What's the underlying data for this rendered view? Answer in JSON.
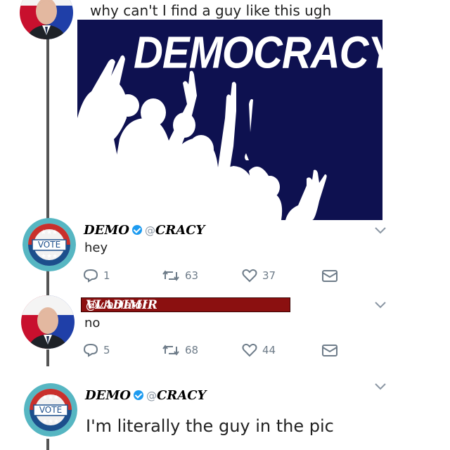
{
  "top_tweet": {
    "text": "why can't I find a guy like this ugh"
  },
  "image": {
    "title": "DEMOCRACY!",
    "bg_color": "#0e1150"
  },
  "reply1": {
    "name_left": "DEMO",
    "handle": "@",
    "name_right": "CRACY",
    "text": "hey",
    "replies": "1",
    "retweets": "63",
    "likes": "37"
  },
  "reply2": {
    "name": "VLADIMIR",
    "handle": "@vladiator",
    "text": "no",
    "replies": "5",
    "retweets": "68",
    "likes": "44"
  },
  "reply3": {
    "name_left": "DEMO",
    "handle": "@",
    "name_right": "CRACY",
    "text": "I'm literally the guy in the pic"
  },
  "vote_badge": {
    "label": "VOTE",
    "stars": "★★★"
  },
  "icons": [
    "reply-icon",
    "retweet-icon",
    "like-icon",
    "dm-icon",
    "chevron-down-icon",
    "verified-icon"
  ],
  "colors": {
    "thread_line": "#555555",
    "action_gray": "#6e7c89",
    "verified_blue": "#1d9bf0",
    "name_banner": "#8b1010"
  }
}
